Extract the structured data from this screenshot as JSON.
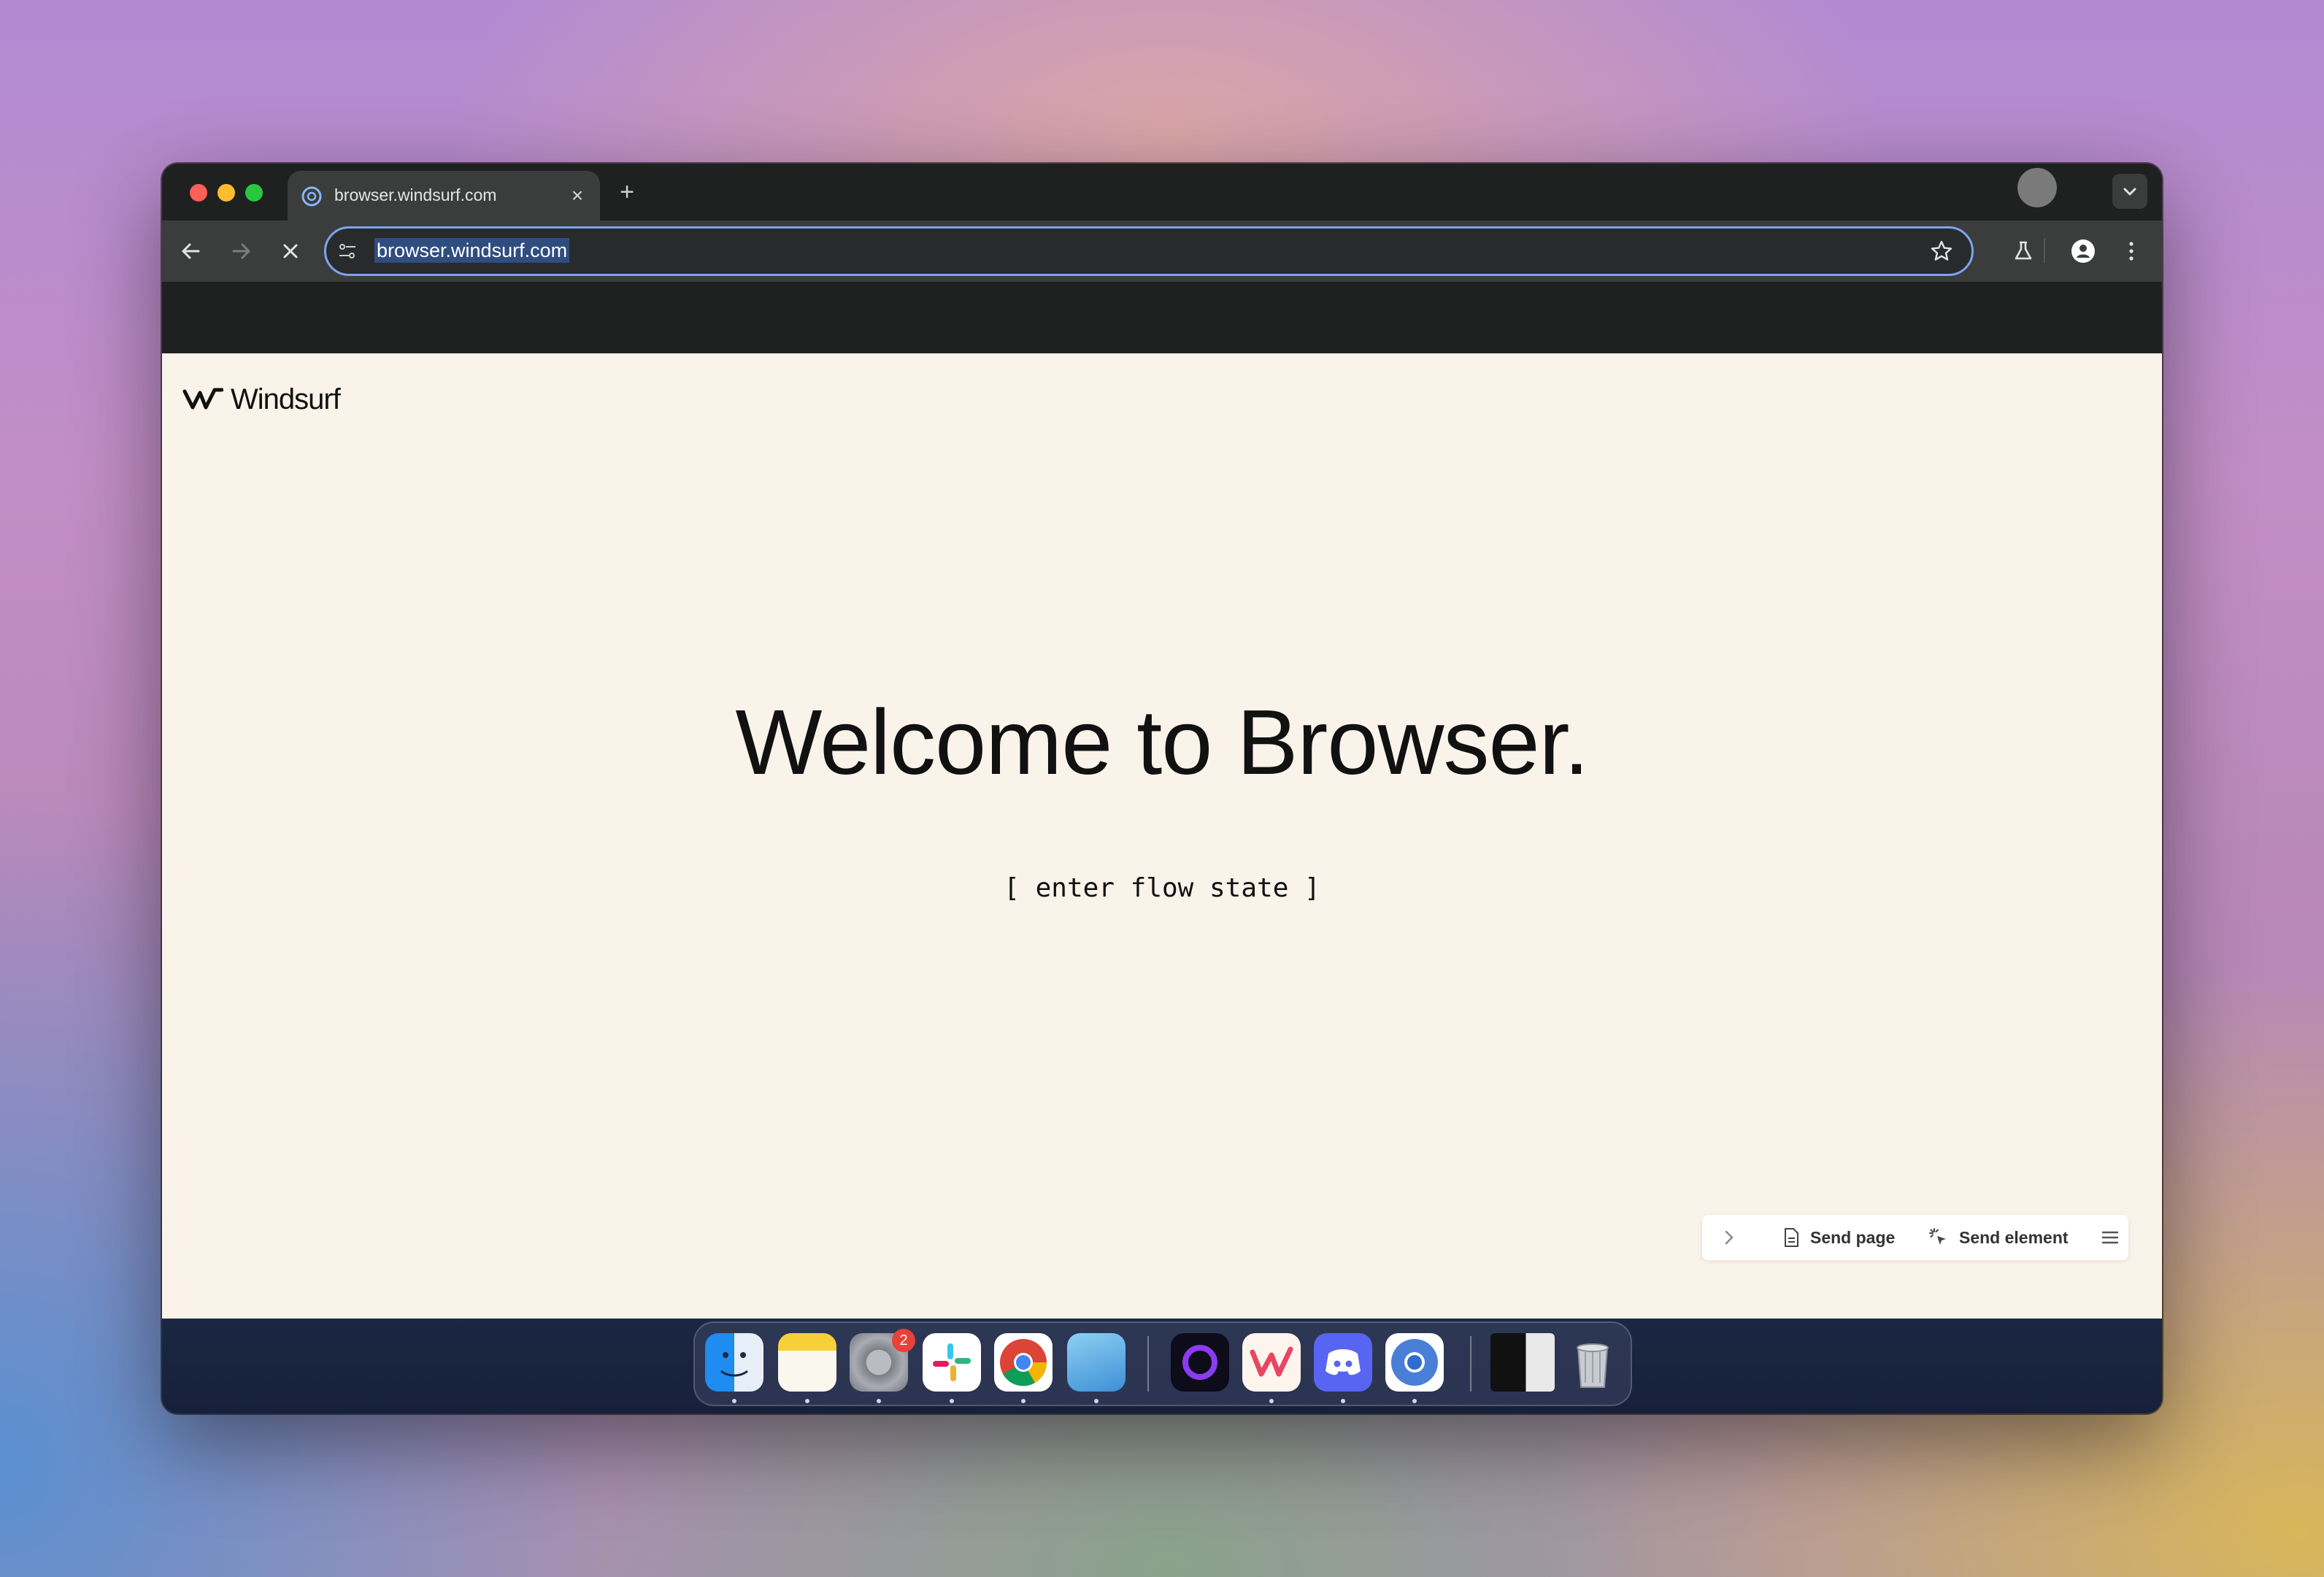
{
  "tab": {
    "title": "browser.windsurf.com"
  },
  "omnibox": {
    "url": "browser.windsurf.com"
  },
  "page": {
    "brand": "Windsurf",
    "headline": "Welcome to Browser.",
    "tagline": "[ enter flow state ]"
  },
  "sendbar": {
    "send_page": "Send page",
    "send_element": "Send element"
  },
  "dock": {
    "apps": [
      "finder-icon",
      "notes-icon",
      "system-settings-icon",
      "slack-icon",
      "chrome-icon",
      "preview-icon",
      "orb-icon",
      "windsurf-icon",
      "discord-icon",
      "chromium-icon",
      "window-preview",
      "trash-icon"
    ],
    "settings_badge": "2"
  },
  "colors": {
    "accent": "#7aa4f2",
    "page_bg": "#faf3ea",
    "chrome_dark": "#1f2121",
    "toolbar": "#3b3c3c"
  }
}
